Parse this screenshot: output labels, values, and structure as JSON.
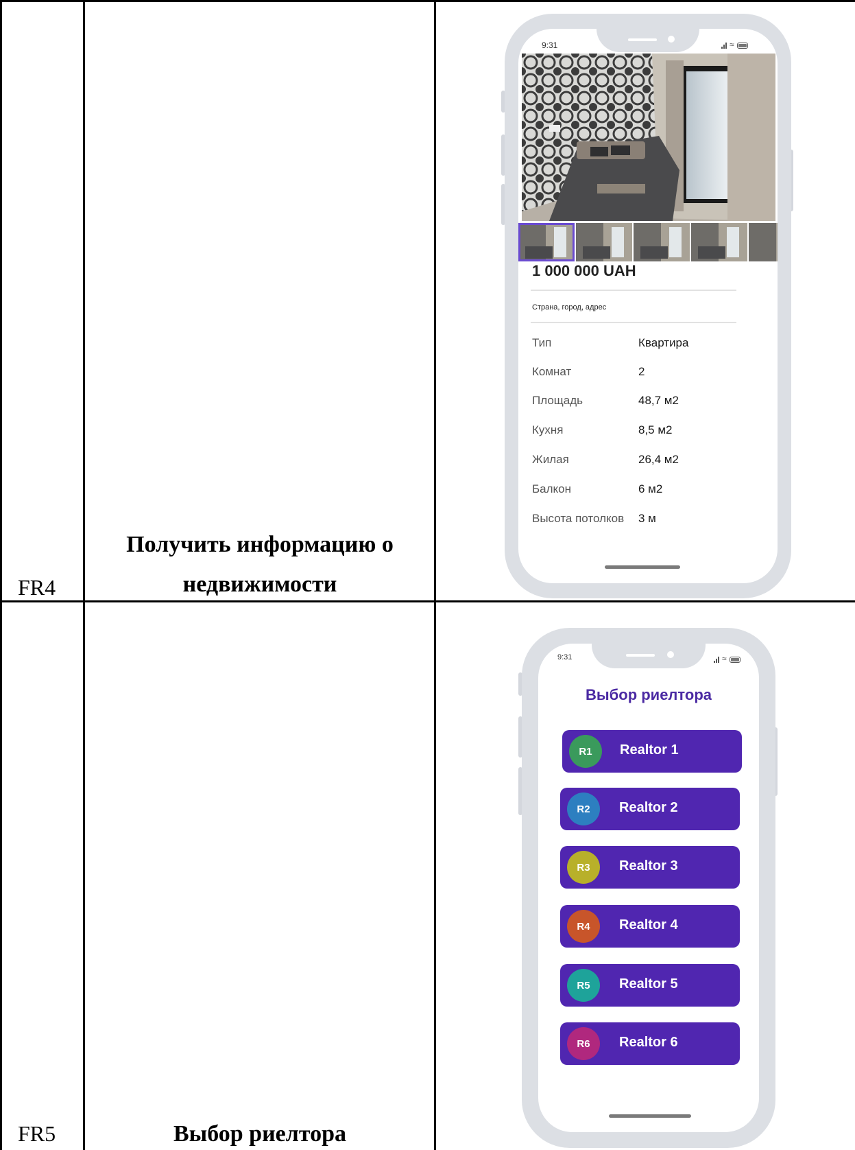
{
  "rows": [
    {
      "id": "FR4",
      "title_line1": "Получить информацию о",
      "title_line2": "недвижимости",
      "phone": {
        "time": "9:31",
        "price": "1 000 000 UAH",
        "address": "Страна, город, адрес",
        "properties": [
          {
            "label": "Тип",
            "value": "Квартира"
          },
          {
            "label": "Комнат",
            "value": "2"
          },
          {
            "label": "Площадь",
            "value": "48,7 м2"
          },
          {
            "label": "Кухня",
            "value": "8,5 м2"
          },
          {
            "label": "Жилая",
            "value": "26,4 м2"
          },
          {
            "label": "Балкон",
            "value": "6 м2"
          },
          {
            "label": "Высота потолков",
            "value": "3 м"
          }
        ]
      }
    },
    {
      "id": "FR5",
      "title_line1": "Выбор риелтора",
      "phone": {
        "time": "9:31",
        "title": "Выбор риелтора",
        "realtors": [
          {
            "badge": "R1",
            "name": "Realtor 1",
            "color": "#3a9a5c"
          },
          {
            "badge": "R2",
            "name": "Realtor 2",
            "color": "#2d7fc0"
          },
          {
            "badge": "R3",
            "name": "Realtor 3",
            "color": "#b8b02a"
          },
          {
            "badge": "R4",
            "name": "Realtor 4",
            "color": "#c8552a"
          },
          {
            "badge": "R5",
            "name": "Realtor 5",
            "color": "#1ea39a"
          },
          {
            "badge": "R6",
            "name": "Realtor 6",
            "color": "#b0287e"
          }
        ]
      }
    }
  ],
  "colors": {
    "accent": "#5026b0",
    "title_purple": "#4b2aa3",
    "phone_frame": "#dcdfe4"
  },
  "icons": [
    "signal-icon",
    "wifi-icon",
    "battery-icon"
  ]
}
